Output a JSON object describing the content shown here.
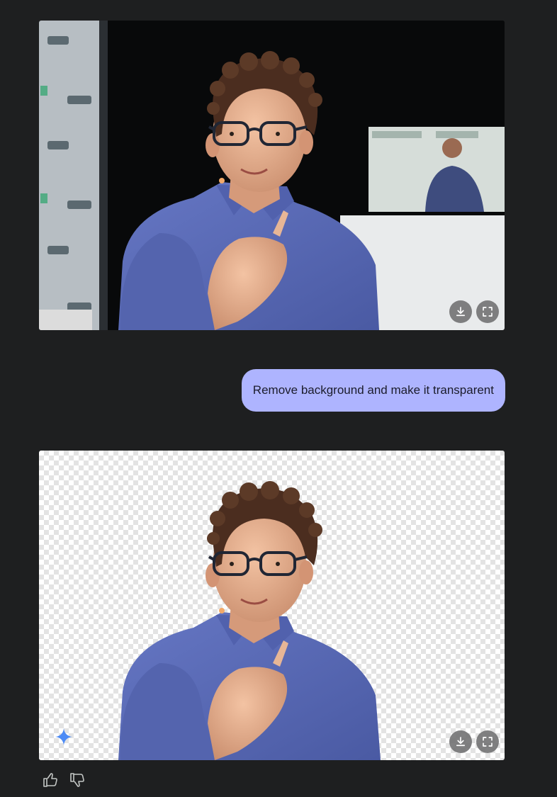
{
  "conversation": {
    "original_image": {
      "alt": "Man with curly hair and glasses in a blue shirt speaking on stage",
      "actions": {
        "download_icon": "download-icon",
        "fullscreen_icon": "fullscreen-icon"
      }
    },
    "user_message": {
      "text": "Remove background and make it transparent"
    },
    "result_image": {
      "alt": "Same man with the background removed on a transparent checkerboard",
      "badge_icon": "gemini-spark-icon",
      "actions": {
        "download_icon": "download-icon",
        "fullscreen_icon": "fullscreen-icon"
      }
    },
    "feedback": {
      "thumbs_up_icon": "thumbs-up-icon",
      "thumbs_down_icon": "thumbs-down-icon"
    }
  },
  "colors": {
    "page_background": "#1e1f20",
    "user_bubble": "#aeb4ff",
    "user_bubble_text": "#1b1c2b",
    "shirt_blue": "#5a6bb8",
    "spark_blue": "#4d8bf5"
  }
}
